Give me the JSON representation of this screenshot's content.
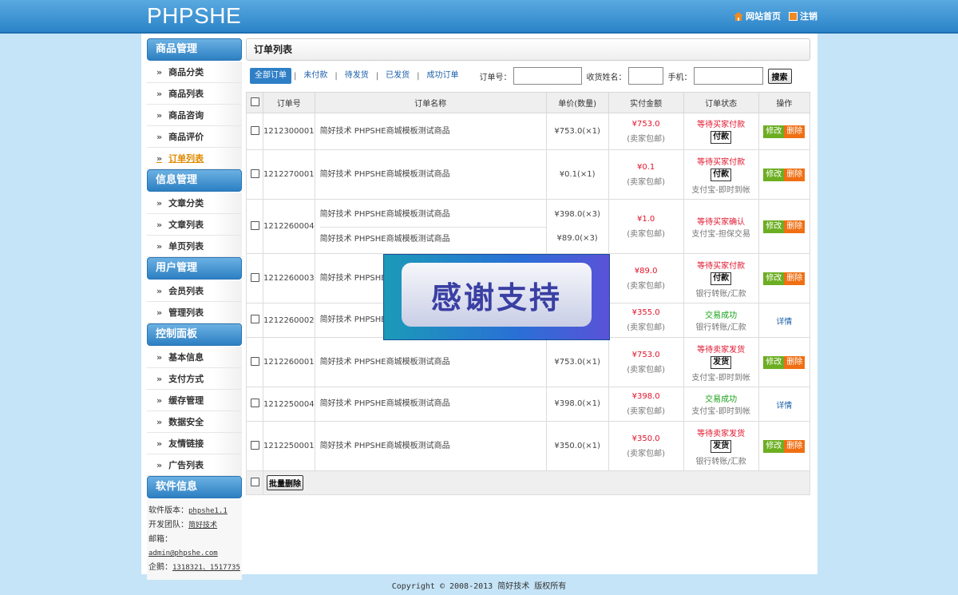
{
  "header": {
    "logo": "PHPSHE",
    "home_label": "网站首页",
    "logout_label": "注销"
  },
  "sidebar": {
    "groups": [
      {
        "title": "商品管理",
        "items": [
          "商品分类",
          "商品列表",
          "商品咨询",
          "商品评价",
          "订单列表"
        ]
      },
      {
        "title": "信息管理",
        "items": [
          "文章分类",
          "文章列表",
          "单页列表"
        ]
      },
      {
        "title": "用户管理",
        "items": [
          "会员列表",
          "管理列表"
        ]
      },
      {
        "title": "控制面板",
        "items": [
          "基本信息",
          "支付方式",
          "缓存管理",
          "数据安全",
          "友情链接",
          "广告列表"
        ]
      },
      {
        "title": "软件信息",
        "items": []
      }
    ],
    "arrow": "»",
    "softinfo": {
      "version_label": "软件版本：",
      "version": "phpshe1.1",
      "team_label": "开发团队：",
      "team": "简好技术",
      "email_label": "邮箱：",
      "email": "admin@phpshe.com",
      "qq_label": "企鹅：",
      "qq": "1318321、1517735"
    }
  },
  "main": {
    "title": "订单列表",
    "tabs": [
      "全部订单",
      "未付款",
      "待发货",
      "已发货",
      "成功订单"
    ],
    "separator": "|",
    "filters": {
      "order_no_label": "订单号：",
      "name_label": "收货姓名：",
      "phone_label": "手机：",
      "search_label": "搜索"
    },
    "columns": [
      "订单号",
      "订单名称",
      "单价(数量)",
      "实付金额",
      "订单状态",
      "操作"
    ],
    "orders": [
      {
        "id": "1212300001",
        "items": [
          {
            "name": "简好技术 PHPSHE商城模板测试商品",
            "price": "¥753.0(×1)"
          }
        ],
        "paid": "¥753.0",
        "ship": "(卖家包邮)",
        "status": "等待买家付款",
        "status_color": "red",
        "action_btn": "付款",
        "pay_method": "",
        "ops": "edit"
      },
      {
        "id": "1212270001",
        "items": [
          {
            "name": "简好技术 PHPSHE商城模板测试商品",
            "price": "¥0.1(×1)"
          }
        ],
        "paid": "¥0.1",
        "ship": "(卖家包邮)",
        "status": "等待买家付款",
        "status_color": "red",
        "action_btn": "付款",
        "pay_method": "支付宝-即时到帐",
        "ops": "edit"
      },
      {
        "id": "1212260004",
        "items": [
          {
            "name": "简好技术 PHPSHE商城模板测试商品",
            "price": "¥398.0(×3)"
          },
          {
            "name": "简好技术 PHPSHE商城模板测试商品",
            "price": "¥89.0(×3)"
          }
        ],
        "paid": "¥1.0",
        "ship": "(卖家包邮)",
        "status": "等待买家确认",
        "status_color": "red",
        "action_btn": "",
        "pay_method": "支付宝-担保交易",
        "ops": "edit"
      },
      {
        "id": "1212260003",
        "items": [
          {
            "name": "简好技术 PHPSHE商",
            "price": ""
          }
        ],
        "paid": "¥89.0",
        "ship": "(卖家包邮)",
        "status": "等待买家付款",
        "status_color": "red",
        "action_btn": "付款",
        "pay_method": "银行转账/汇款",
        "ops": "edit"
      },
      {
        "id": "1212260002",
        "items": [
          {
            "name": "简好技术 PHPSHE商",
            "price": ""
          }
        ],
        "paid": "¥355.0",
        "ship": "(卖家包邮)",
        "status": "交易成功",
        "status_color": "green",
        "action_btn": "",
        "pay_method": "银行转账/汇款",
        "ops": "detail"
      },
      {
        "id": "1212260001",
        "items": [
          {
            "name": "简好技术 PHPSHE商城模板测试商品",
            "price": "¥753.0(×1)"
          }
        ],
        "paid": "¥753.0",
        "ship": "(卖家包邮)",
        "status": "等待卖家发货",
        "status_color": "red",
        "action_btn": "发货",
        "pay_method": "支付宝-即时到帐",
        "ops": "edit"
      },
      {
        "id": "1212250004",
        "items": [
          {
            "name": "简好技术 PHPSHE商城模板测试商品",
            "price": "¥398.0(×1)"
          }
        ],
        "paid": "¥398.0",
        "ship": "(卖家包邮)",
        "status": "交易成功",
        "status_color": "green",
        "action_btn": "",
        "pay_method": "支付宝-即时到帐",
        "ops": "detail"
      },
      {
        "id": "1212250001",
        "items": [
          {
            "name": "简好技术 PHPSHE商城模板测试商品",
            "price": "¥350.0(×1)"
          }
        ],
        "paid": "¥350.0",
        "ship": "(卖家包邮)",
        "status": "等待卖家发货",
        "status_color": "red",
        "action_btn": "发货",
        "pay_method": "银行转账/汇款",
        "ops": "edit"
      }
    ],
    "op_labels": {
      "edit": "修改",
      "delete": "删除",
      "detail": "详情"
    },
    "batch_delete_label": "批量删除"
  },
  "banner": {
    "text": "感谢支持"
  },
  "footer": {
    "text": "Copyright © 2008-2013 简好技术 版权所有"
  }
}
